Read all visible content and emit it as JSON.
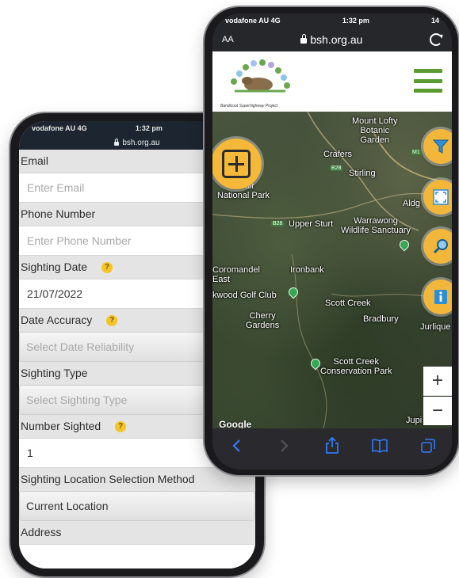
{
  "form_phone": {
    "status": {
      "carrier": "vodafone AU 4G",
      "time": "1:32 pm"
    },
    "url": "bsh.org.au",
    "fields": [
      {
        "label": "Email",
        "value": "Enter Email",
        "kind": "input",
        "placeholder": true
      },
      {
        "label": "Phone Number",
        "value": "Enter Phone Number",
        "kind": "input",
        "placeholder": true
      },
      {
        "label": "Sighting Date",
        "help": true,
        "value": "21/07/2022",
        "kind": "input",
        "placeholder": false
      },
      {
        "label": "Date Accuracy",
        "help": true,
        "value": "Select Date Reliability",
        "kind": "select",
        "placeholder": true
      },
      {
        "label": "Sighting Type",
        "value": "Select Sighting Type",
        "kind": "select",
        "placeholder": true
      },
      {
        "label": "Number Sighted",
        "help": true,
        "value": "1",
        "kind": "input",
        "placeholder": false
      },
      {
        "label": "Sighting Location Selection Method",
        "value": "Current Location",
        "kind": "select",
        "placeholder": false
      },
      {
        "label": "Address"
      }
    ]
  },
  "map_phone": {
    "status": {
      "carrier": "vodafone AU 4G",
      "time": "1:32 pm",
      "battery": "14"
    },
    "url_bar": {
      "text_size_label": "AA",
      "url": "bsh.org.au"
    },
    "logo_caption": "Bandicoot Superhighway Project",
    "map_labels": {
      "mount_lofty": "Mount Lofty\nBotanic\nGarden",
      "crafers": "Crafers",
      "stirling": "Stirling",
      "aldgate": "Aldg",
      "belair": "Belair\nNational Park",
      "upper_sturt": "Upper Sturt",
      "warrawong": "Warrawong\nWildlife Sanctuary",
      "coromandel": "Coromandel\nEast",
      "ironbank": "Ironbank",
      "golf": "kwood Golf Club",
      "scott_creek": "Scott Creek",
      "cherry": "Cherry\nGardens",
      "bradbury": "Bradbury",
      "jurlique": "Jurlique",
      "park": "Scott Creek\nConservation Park",
      "jupiter": "Jupi",
      "google": "Google"
    },
    "road_badges": {
      "b28": "B28",
      "b28b": "B28",
      "m1": "M1"
    },
    "zoom": {
      "in": "+",
      "out": "−"
    }
  },
  "colors": {
    "accent": "#f5b838",
    "menu_green": "#5a9b32",
    "help_yellow": "#f4c52a"
  }
}
